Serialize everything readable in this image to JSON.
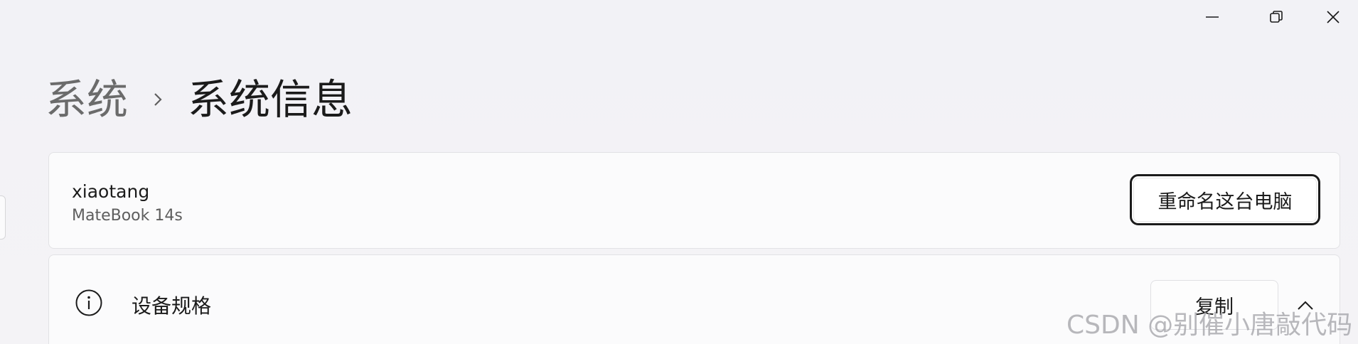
{
  "window": {
    "caption": {
      "minimize_icon": "minimize-icon",
      "maximize_icon": "restore-icon",
      "close_icon": "close-icon"
    }
  },
  "breadcrumb": {
    "parent": "系统",
    "separator_icon": "chevron-right-icon",
    "current": "系统信息"
  },
  "device": {
    "name": "xiaotang",
    "model": "MateBook 14s",
    "rename_label": "重命名这台电脑"
  },
  "specs": {
    "icon": "info-icon",
    "label": "设备规格",
    "copy_label": "复制",
    "toggle_icon": "chevron-up-icon"
  },
  "watermark": "CSDN @别催小唐敲代码",
  "colors": {
    "background": "#f3f3f5",
    "card": "#fbfbfc",
    "text": "#1b1b1b",
    "secondary_text": "#5e5e5e",
    "breadcrumb_parent": "#6b6b6b"
  }
}
